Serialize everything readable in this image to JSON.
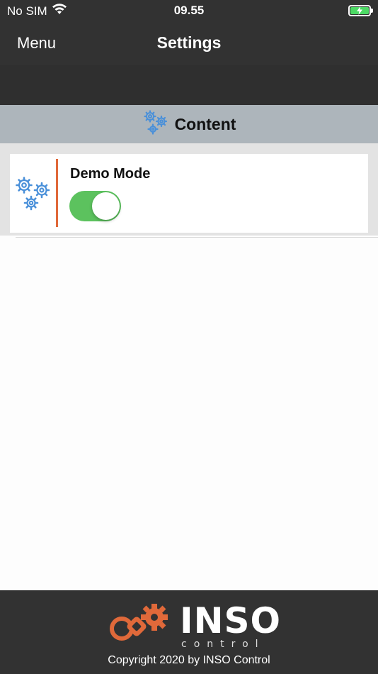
{
  "status_bar": {
    "carrier": "No SIM",
    "time": "09.55",
    "wifi_icon": "wifi-icon",
    "battery_icon": "battery-charging-icon"
  },
  "nav": {
    "menu_label": "Menu",
    "title": "Settings"
  },
  "section": {
    "title": "Content",
    "icon": "gears-icon"
  },
  "items": [
    {
      "label": "Demo Mode",
      "icon": "gears-icon",
      "toggle_on": true
    }
  ],
  "footer": {
    "logo_text": "INSO",
    "logo_sub": "control",
    "copyright": "Copyright 2020 by INSO Control"
  },
  "colors": {
    "bar_bg": "#323232",
    "section_bg": "#adb5bb",
    "accent": "#e0693a",
    "toggle_on": "#5cc25e",
    "gear_blue": "#4a90d9"
  }
}
